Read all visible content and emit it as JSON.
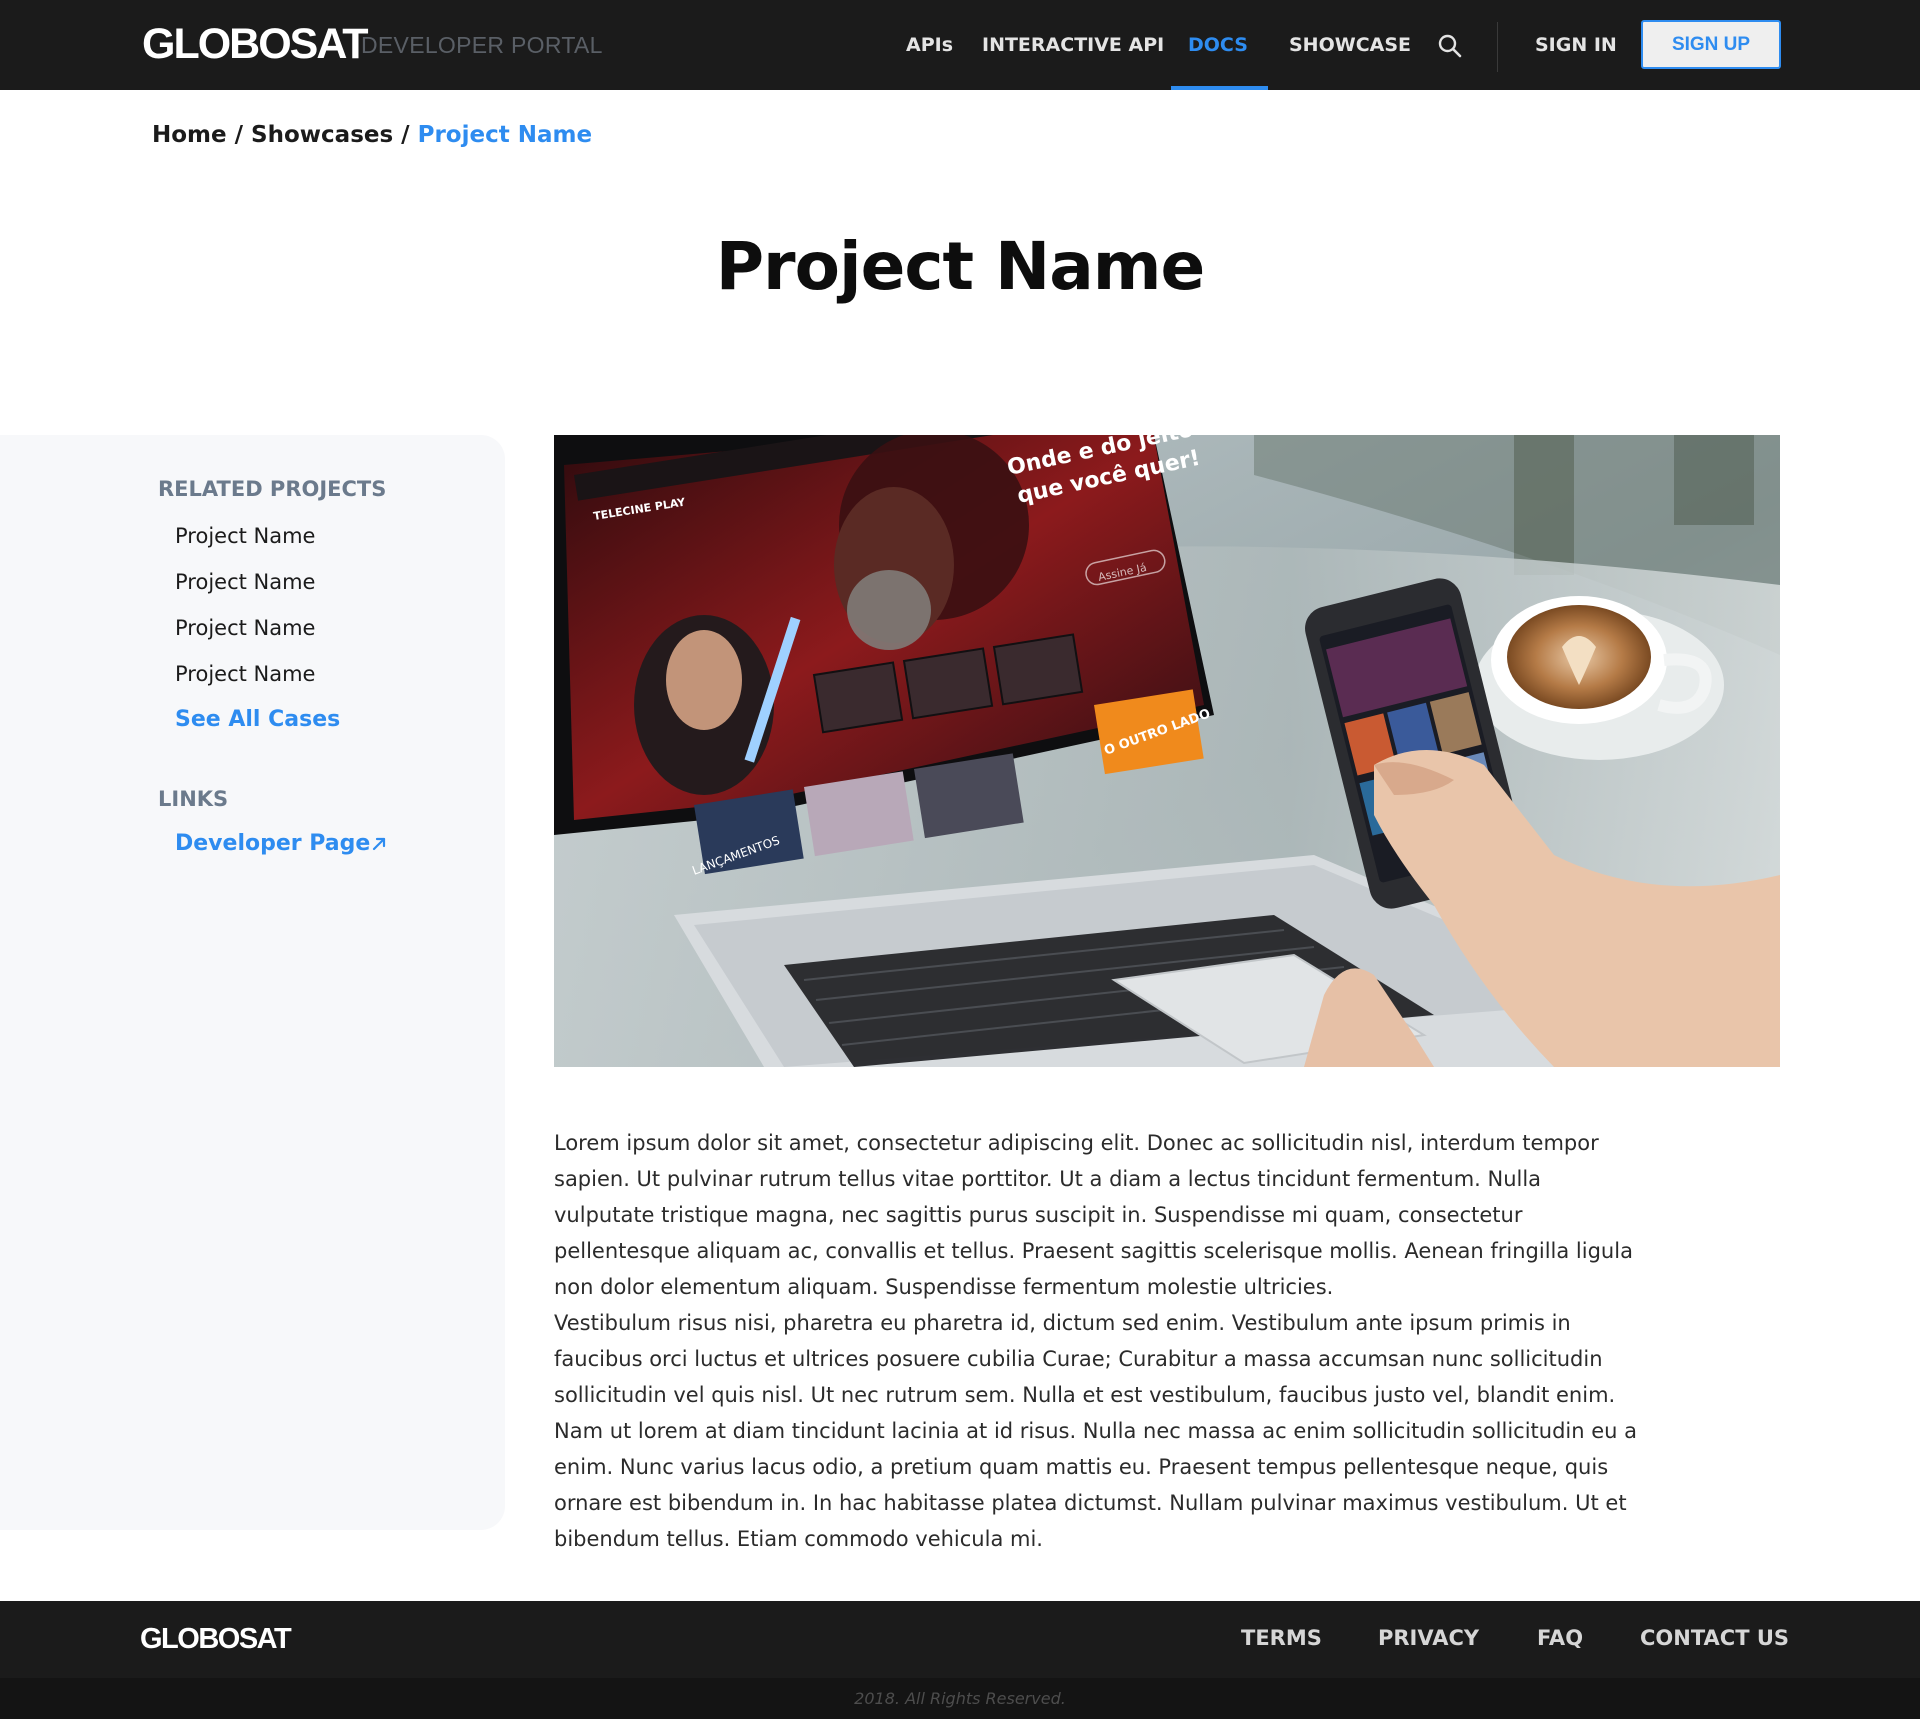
{
  "header": {
    "logo": "GLOBOSAT",
    "subtitle": "DEVELOPER PORTAL",
    "nav": {
      "apis": "APIs",
      "interactive_api": "INTERACTIVE API",
      "docs": "DOCS",
      "showcase": "SHOWCASE"
    },
    "active_item": "DOCS",
    "sign_in": "SIGN IN",
    "sign_up": "SIGN UP"
  },
  "breadcrumb": {
    "home": "Home",
    "separator": " / ",
    "showcases": "Showcases",
    "current": "Project Name"
  },
  "page_title": "Project Name",
  "sidebar": {
    "related_heading": "RELATED PROJECTS",
    "related_items": [
      "Project Name",
      "Project Name",
      "Project Name",
      "Project Name"
    ],
    "see_all": "See All Cases",
    "links_heading": "LINKS",
    "developer_page": "Developer Page"
  },
  "hero_image": {
    "laptop_headline_1": "Onde e do jeito",
    "laptop_headline_2": "que você quer!",
    "laptop_button": "Assine Já",
    "laptop_row_label": "LANÇAMENTOS",
    "laptop_tile_label": "O OUTRO LADO",
    "laptop_brand": "TELECINE PLAY"
  },
  "content": {
    "paragraph_1": "Lorem ipsum dolor sit amet, consectetur adipiscing elit. Donec ac sollicitudin nisl, interdum tempor sapien. Ut pulvinar rutrum tellus vitae porttitor. Ut a diam a lectus tincidunt fermentum. Nulla vulputate tristique magna, nec sagittis purus suscipit in. Suspendisse mi quam, consectetur pellentesque aliquam ac, convallis et tellus. Praesent sagittis scelerisque mollis. Aenean fringilla ligula non dolor elementum aliquam. Suspendisse fermentum molestie ultricies.",
    "paragraph_2": "Vestibulum risus nisi, pharetra eu pharetra id, dictum sed enim. Vestibulum ante ipsum primis in faucibus orci luctus et ultrices posuere cubilia Curae; Curabitur a massa accumsan nunc sollicitudin sollicitudin vel quis nisl. Ut nec rutrum sem. Nulla et est vestibulum, faucibus justo vel, blandit enim. Nam ut lorem at diam tincidunt lacinia at id risus. Nulla nec massa ac enim sollicitudin sollicitudin eu a enim. Nunc varius lacus odio, a pretium quam mattis eu. Praesent tempus pellentesque neque, quis ornare est bibendum in. In hac habitasse platea dictumst. Nullam pulvinar maximus vestibulum. Ut et bibendum tellus. Etiam commodo vehicula mi."
  },
  "footer": {
    "logo": "GLOBOSAT",
    "links": {
      "terms": "TERMS",
      "privacy": "PRIVACY",
      "faq": "FAQ",
      "contact": "CONTACT US"
    },
    "copyright": "2018. All Rights Reserved."
  },
  "colors": {
    "nav_background": "#1b1b1b",
    "accent": "#2e8cf0",
    "sidebar_background": "#f7f8fa",
    "sidebar_heading": "#6b7a8c"
  },
  "icons": {
    "search": "search-icon",
    "external_link": "external-link-icon"
  }
}
